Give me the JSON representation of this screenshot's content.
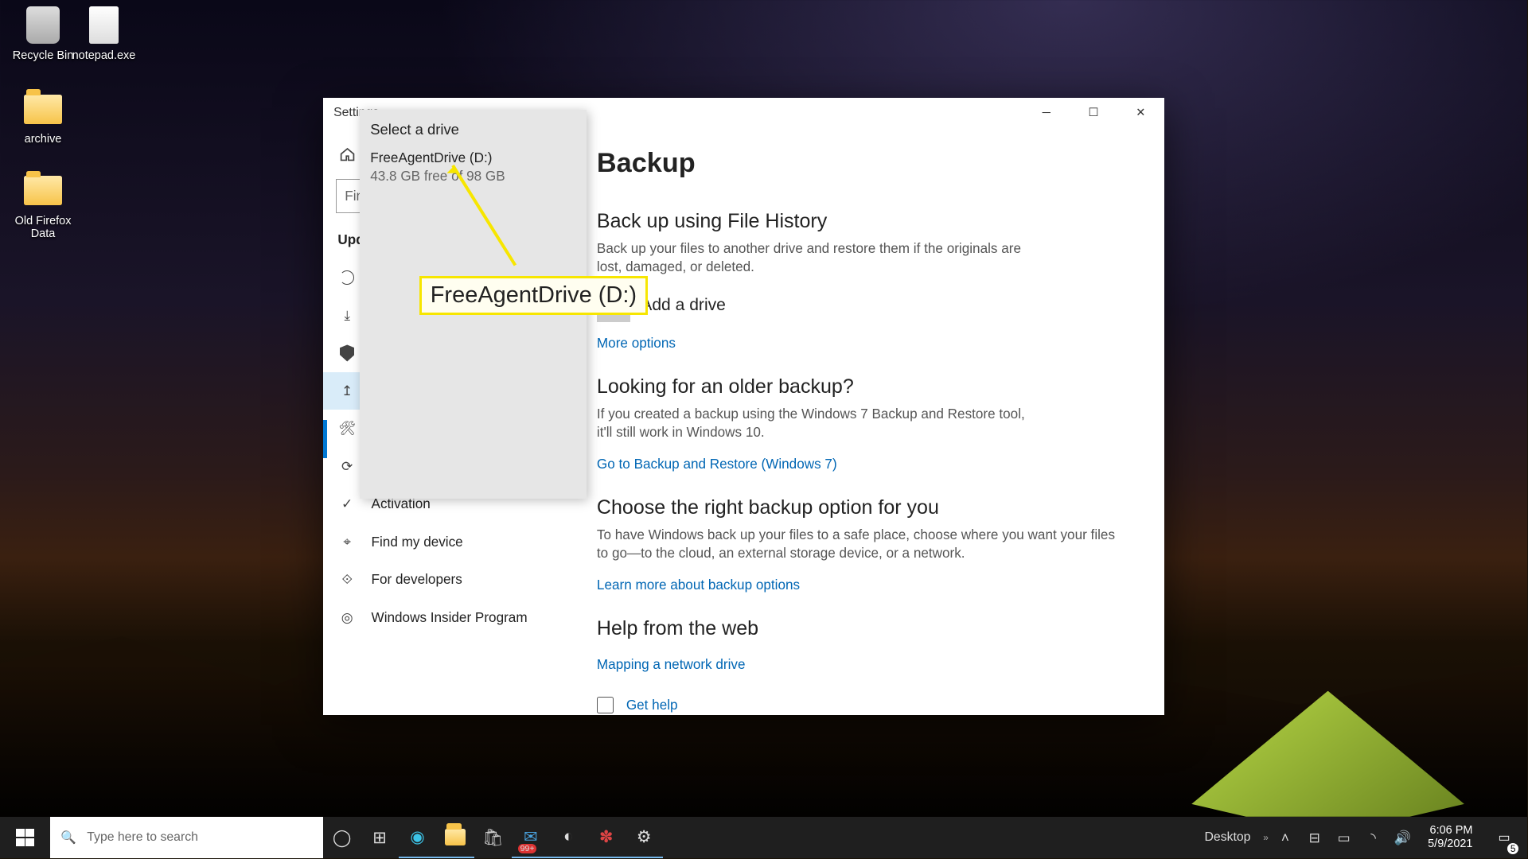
{
  "desktop": {
    "icons": [
      {
        "label": "Recycle Bin"
      },
      {
        "label": "notepad.exe"
      },
      {
        "label": "archive"
      },
      {
        "label": "Old Firefox Data"
      }
    ]
  },
  "window": {
    "title": "Settings",
    "home": "Home",
    "search_placeholder": "Find a setting",
    "section": "Update & Security",
    "sidebar": [
      "Windows Update",
      "Delivery Optimization",
      "Windows Security",
      "Backup",
      "Troubleshoot",
      "Recovery",
      "Activation",
      "Find my device",
      "For developers",
      "Windows Insider Program"
    ]
  },
  "content": {
    "title": "Backup",
    "fh_head": "Back up using File History",
    "fh_desc": "Back up your files to another drive and restore them if the originals are lost, damaged, or deleted.",
    "add_drive": "Add a drive",
    "more_options": "More options",
    "older_head": "Looking for an older backup?",
    "older_desc": "If you created a backup using the Windows 7 Backup and Restore tool, it'll still work in Windows 10.",
    "older_link": "Go to Backup and Restore (Windows 7)",
    "choose_head": "Choose the right backup option for you",
    "choose_desc": "To have Windows back up your files to a safe place, choose where you want your files to go—to the cloud, an external storage device, or a network.",
    "choose_link": "Learn more about backup options",
    "web_head": "Help from the web",
    "web_link": "Mapping a network drive",
    "get_help": "Get help"
  },
  "flyout": {
    "title": "Select a drive",
    "drive_name": "FreeAgentDrive (D:)",
    "drive_free": "43.8 GB free of 98 GB"
  },
  "annotation": {
    "label": "FreeAgentDrive (D:)"
  },
  "taskbar": {
    "search_placeholder": "Type here to search",
    "desktop_label": "Desktop",
    "mail_badge": "99+",
    "time": "6:06 PM",
    "date": "5/9/2021",
    "notif_count": "5"
  }
}
